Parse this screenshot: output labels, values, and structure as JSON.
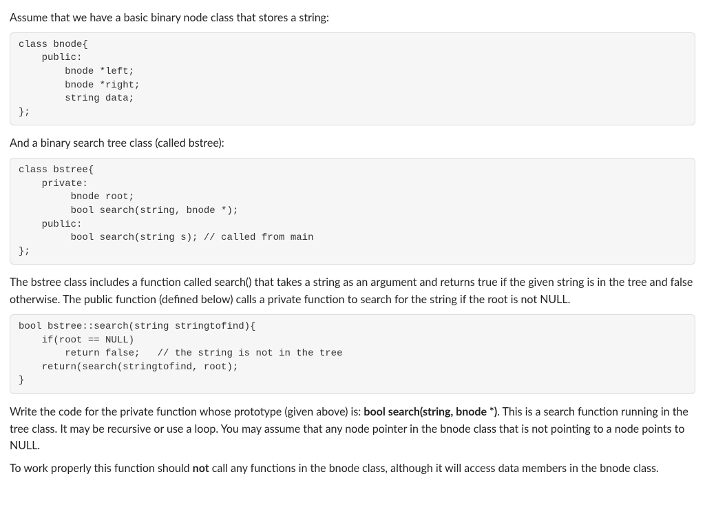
{
  "p1": "Assume that we have a basic binary node class that stores a string:",
  "code1": "class bnode{\n    public:\n        bnode *left;\n        bnode *right;\n        string data;\n};",
  "p2": "And a binary search tree class (called bstree):",
  "code2": "class bstree{\n    private:\n         bnode root;\n         bool search(string, bnode *);\n    public:\n         bool search(string s); // called from main\n};",
  "p3": "The bstree class includes a function called search() that takes a string as an argument and returns true if the given string is in the tree and false otherwise.  The public function (defined below) calls a private function to search for the string if the root is not NULL.",
  "code3": "bool bstree::search(string stringtofind){\n    if(root == NULL)\n        return false;   // the string is not in the tree\n    return(search(stringtofind, root);\n}",
  "p4_a": "Write the code for the private function whose prototype (given above) is: ",
  "p4_b": "bool search(string, bnode *)",
  "p4_c": ". This is a search function running in the tree class. It may be recursive or use a loop. You may assume that any node pointer in the bnode class that is not pointing to a node points to NULL.",
  "p5_a": "To work properly this function should ",
  "p5_b": "not",
  "p5_c": " call any functions in the bnode class, although it will access data members in the bnode class."
}
